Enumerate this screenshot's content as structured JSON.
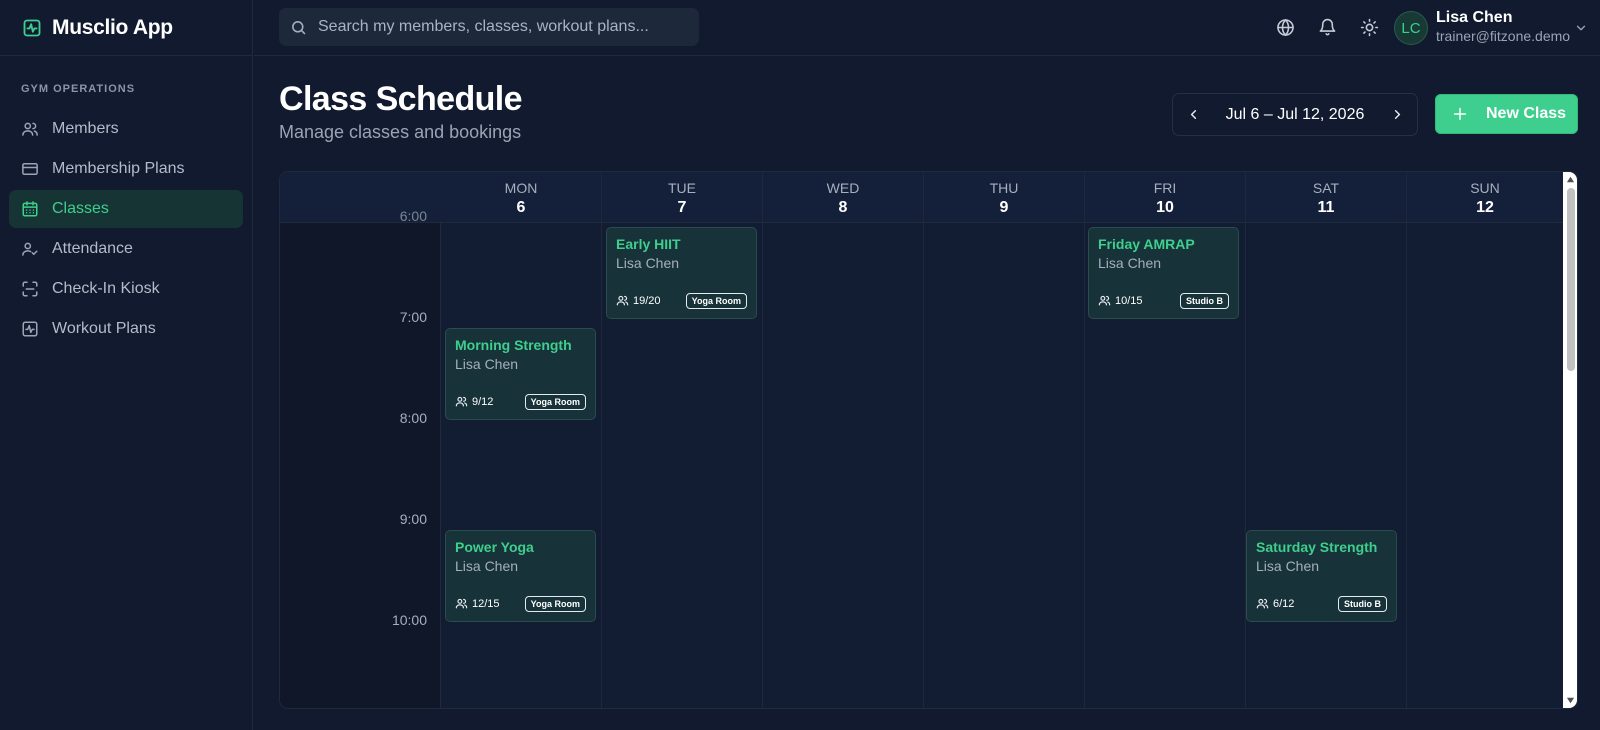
{
  "app": {
    "name": "Musclio App"
  },
  "sidebar": {
    "section_label": "GYM OPERATIONS",
    "items": [
      {
        "label": "Members",
        "icon": "users-icon"
      },
      {
        "label": "Membership Plans",
        "icon": "credit-card-icon"
      },
      {
        "label": "Classes",
        "icon": "calendar-icon",
        "active": true
      },
      {
        "label": "Attendance",
        "icon": "user-check-icon"
      },
      {
        "label": "Check-In Kiosk",
        "icon": "scan-icon"
      },
      {
        "label": "Workout Plans",
        "icon": "activity-icon"
      }
    ]
  },
  "topbar": {
    "search_placeholder": "Search my members, classes, workout plans...",
    "user": {
      "initials": "LC",
      "name": "Lisa Chen",
      "email": "trainer@fitzone.demo"
    }
  },
  "page": {
    "title": "Class Schedule",
    "subtitle": "Manage classes and bookings",
    "date_range": "Jul 6 – Jul 12, 2026",
    "new_class_label": "New Class"
  },
  "calendar": {
    "days": [
      {
        "dow": "MON",
        "num": "6"
      },
      {
        "dow": "TUE",
        "num": "7"
      },
      {
        "dow": "WED",
        "num": "8"
      },
      {
        "dow": "THU",
        "num": "9"
      },
      {
        "dow": "FRI",
        "num": "10"
      },
      {
        "dow": "SAT",
        "num": "11"
      },
      {
        "dow": "SUN",
        "num": "12"
      }
    ],
    "times": [
      "6:00",
      "7:00",
      "8:00",
      "9:00",
      "10:00"
    ],
    "events": [
      {
        "title": "Early HIIT",
        "coach": "Lisa Chen",
        "count": "19/20",
        "room": "Yoga Room"
      },
      {
        "title": "Friday AMRAP",
        "coach": "Lisa Chen",
        "count": "10/15",
        "room": "Studio B"
      },
      {
        "title": "Morning Strength",
        "coach": "Lisa Chen",
        "count": "9/12",
        "room": "Yoga Room"
      },
      {
        "title": "Power Yoga",
        "coach": "Lisa Chen",
        "count": "12/15",
        "room": "Yoga Room"
      },
      {
        "title": "Saturday Strength",
        "coach": "Lisa Chen",
        "count": "6/12",
        "room": "Studio B"
      }
    ]
  },
  "colors": {
    "accent": "#3ecf8e",
    "background": "#111a2e",
    "card": "#173238"
  }
}
